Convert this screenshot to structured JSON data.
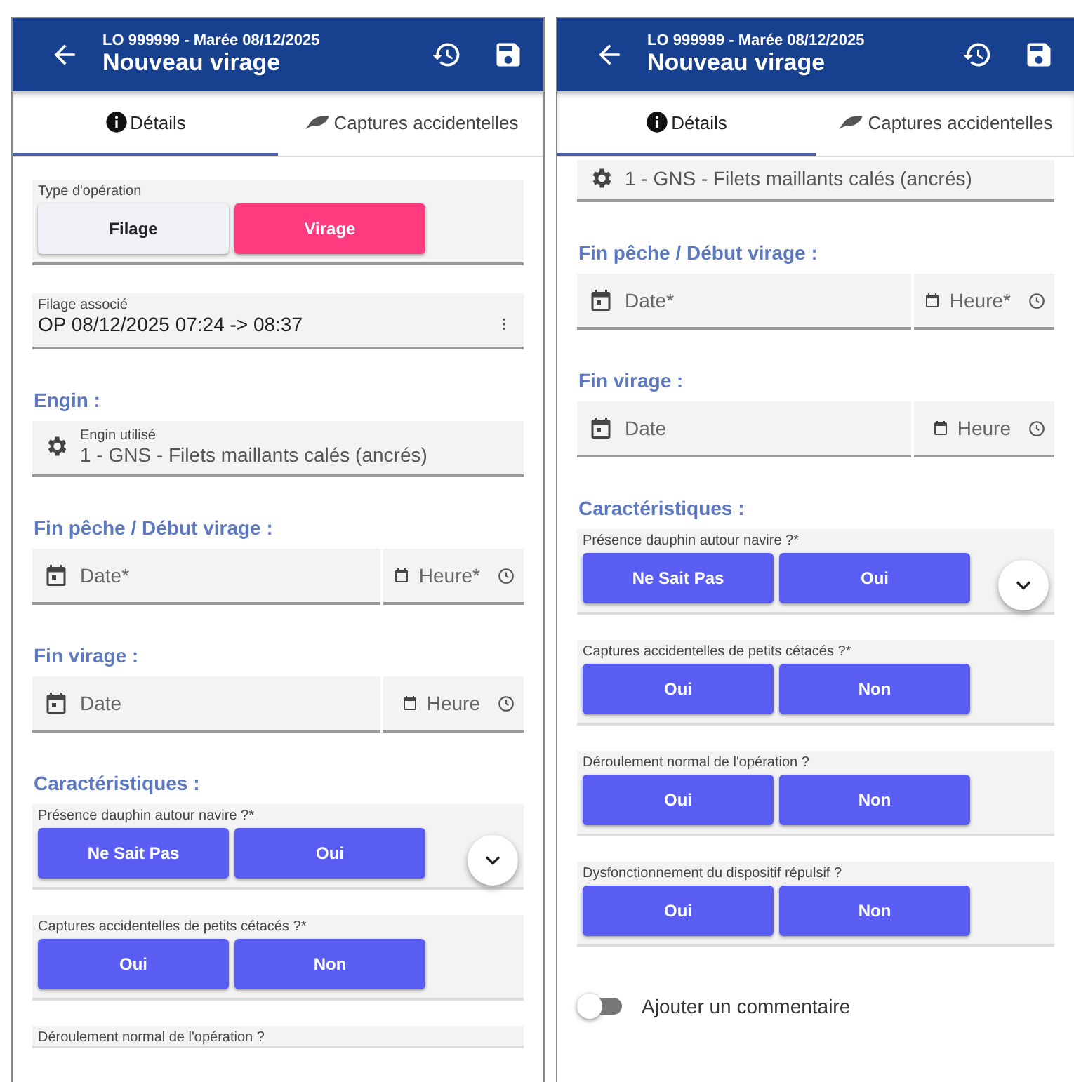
{
  "screens": [
    {
      "header": {
        "subtitle": "LO 999999 - Marée 08/12/2025",
        "title": "Nouveau virage"
      },
      "tabs": [
        {
          "label": "Détails",
          "selected": true
        },
        {
          "label": "Captures accidentelles",
          "selected": false
        }
      ],
      "sections": [
        {
          "kind": "toggle",
          "label": "Type d'opération",
          "options": [
            {
              "label": "Filage",
              "selected": false
            },
            {
              "label": "Virage",
              "selected": true
            }
          ]
        },
        {
          "kind": "select",
          "label": "Filage associé",
          "value": "OP 08/12/2025 07:24 -> 08:37"
        },
        {
          "kind": "heading",
          "text": "Engin :"
        },
        {
          "kind": "engin",
          "label": "Engin utilisé",
          "value": "1 - GNS - Filets maillants calés (ancrés)"
        },
        {
          "kind": "heading",
          "text": "Fin pêche / Début virage :"
        },
        {
          "kind": "datetime",
          "date": "Date*",
          "time": "Heure*"
        },
        {
          "kind": "heading",
          "text": "Fin virage :"
        },
        {
          "kind": "datetime",
          "date": "Date",
          "time": "Heure"
        },
        {
          "kind": "heading",
          "text": "Caractéristiques :"
        },
        {
          "kind": "question",
          "label": "Présence dauphin autour navire ?*",
          "options": [
            "Ne Sait Pas",
            "Oui"
          ],
          "expand_button": true
        },
        {
          "kind": "question",
          "label": "Captures accidentelles de petits cétacés ?*",
          "options": [
            "Oui",
            "Non"
          ],
          "expand_button": false
        },
        {
          "kind": "question",
          "label": "Déroulement normal de l'opération ?"
        }
      ]
    },
    {
      "header": {
        "subtitle": "LO 999999 - Marée 08/12/2025",
        "title": "Nouveau virage"
      },
      "tabs": [
        {
          "label": "Détails",
          "selected": true
        },
        {
          "label": "Captures accidentelles",
          "selected": false
        }
      ],
      "sections": [
        {
          "kind": "engin",
          "value": "1 - GNS - Filets maillants calés (ancrés)"
        },
        {
          "kind": "heading",
          "text": "Fin pêche / Début virage :"
        },
        {
          "kind": "datetime",
          "date": "Date*",
          "time": "Heure*"
        },
        {
          "kind": "heading",
          "text": "Fin virage :"
        },
        {
          "kind": "datetime",
          "date": "Date",
          "time": "Heure"
        },
        {
          "kind": "heading",
          "text": "Caractéristiques :"
        },
        {
          "kind": "question",
          "label": "Présence dauphin autour navire ?*",
          "options": [
            "Ne Sait Pas",
            "Oui"
          ],
          "expand_button": true
        },
        {
          "kind": "question",
          "label": "Captures accidentelles de petits cétacés ?*",
          "options": [
            "Oui",
            "Non"
          ],
          "expand_button": false
        },
        {
          "kind": "question",
          "label": "Déroulement normal de l'opération ?",
          "options": [
            "Oui",
            "Non"
          ],
          "expand_button": false
        },
        {
          "kind": "question",
          "label": "Dysfonctionnement du dispositif répulsif ?",
          "options": [
            "Oui",
            "Non"
          ],
          "expand_button": false
        },
        {
          "kind": "switch",
          "label": "Ajouter un commentaire",
          "on": false
        }
      ]
    }
  ]
}
